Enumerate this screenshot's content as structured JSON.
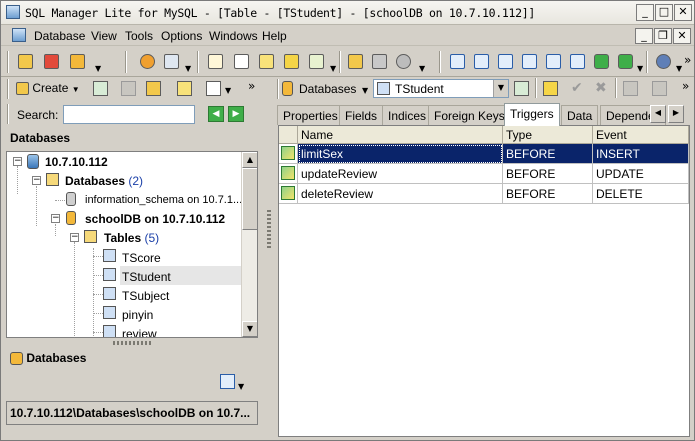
{
  "window": {
    "title": "SQL Manager Lite for MySQL - [Table - [TStudent] - [schoolDB on 10.7.10.112]]",
    "controls": {
      "minimize": "_",
      "maximize": "□",
      "close": "✕"
    }
  },
  "menu": {
    "items": [
      "Database",
      "View",
      "Tools",
      "Options",
      "Windows",
      "Help"
    ],
    "child_controls": {
      "minimize": "_",
      "restore": "❐",
      "close": "✕"
    }
  },
  "toolbar": {
    "more": "»"
  },
  "left": {
    "create_label": "Create",
    "search_label": "Search:",
    "search_value": "",
    "databases_header": "Databases",
    "tree": {
      "server": "10.7.10.112",
      "databases": "Databases",
      "databases_count": "(2)",
      "information_schema": "information_schema on 10.7.1...",
      "schooldb": "schoolDB on 10.7.10.112",
      "tables": "Tables",
      "tables_count": "(5)",
      "items": [
        "TScore",
        "TStudent",
        "TSubject",
        "pinyin",
        "review"
      ]
    },
    "bottom_header": "Databases",
    "status": "10.7.10.112\\Databases\\schoolDB on 10.7..."
  },
  "right": {
    "db_combo_label": "Databases",
    "table_combo_value": "TStudent",
    "tabs": [
      "Properties",
      "Fields",
      "Indices",
      "Foreign Keys",
      "Triggers",
      "Data",
      "Depende"
    ],
    "active_tab": "Triggers",
    "grid": {
      "columns": [
        "Name",
        "Type",
        "Event"
      ],
      "rows": [
        {
          "name": "limitSex",
          "type": "BEFORE",
          "event": "INSERT",
          "selected": true
        },
        {
          "name": "updateReview",
          "type": "BEFORE",
          "event": "UPDATE",
          "selected": false
        },
        {
          "name": "deleteReview",
          "type": "BEFORE",
          "event": "DELETE",
          "selected": false
        }
      ]
    }
  },
  "colors": {
    "selection": "#0a246a",
    "chrome": "#d4d0c8",
    "tree_selected": "#e6e6e6"
  }
}
